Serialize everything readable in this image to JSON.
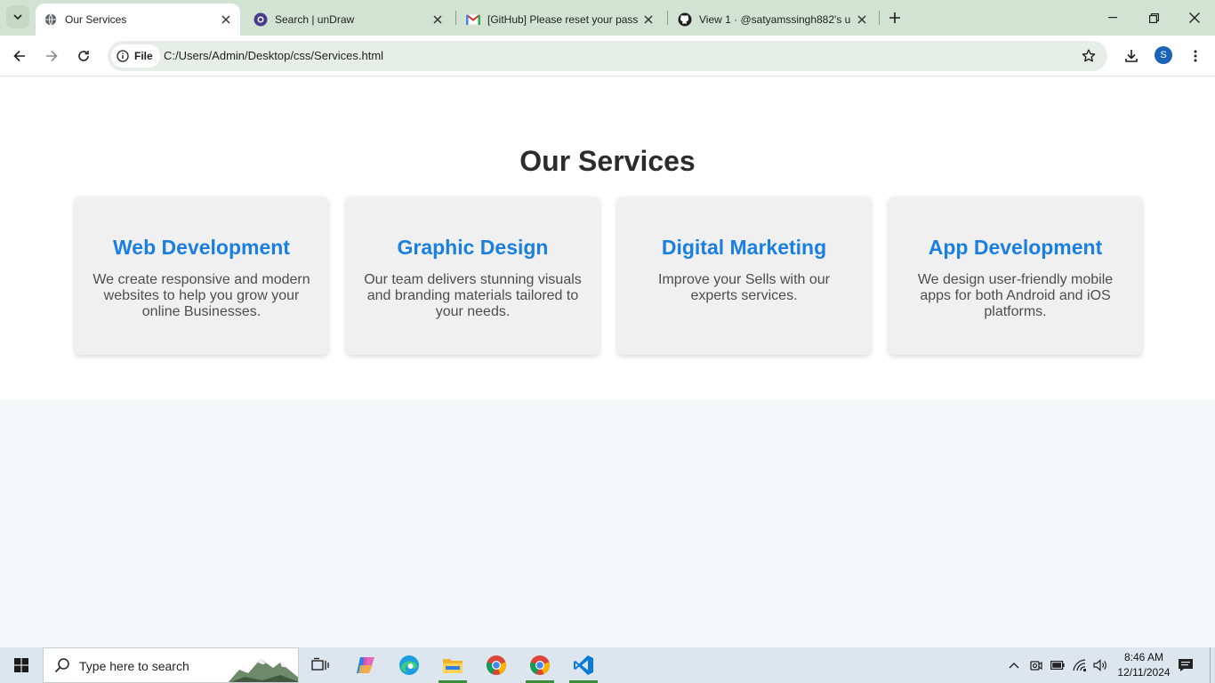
{
  "browser": {
    "tabs": [
      {
        "title": "Our Services",
        "active": true,
        "icon": "globe-icon"
      },
      {
        "title": "Search | unDraw",
        "active": false,
        "icon": "undraw-icon"
      },
      {
        "title": "[GitHub] Please reset your pass",
        "active": false,
        "icon": "gmail-icon"
      },
      {
        "title": "View 1 · @satyamssingh882's u",
        "active": false,
        "icon": "github-icon"
      }
    ],
    "address": {
      "chip_label": "File",
      "url": "C:/Users/Admin/Desktop/css/Services.html"
    },
    "profile_initial": "S"
  },
  "page": {
    "heading": "Our Services",
    "cards": [
      {
        "title": "Web Development",
        "text": "We create responsive and modern websites to help you grow your online Businesses."
      },
      {
        "title": "Graphic Design",
        "text": "Our team delivers stunning visuals and branding materials tailored to your needs."
      },
      {
        "title": "Digital Marketing",
        "text": "Improve your Sells with our experts services."
      },
      {
        "title": "App Development",
        "text": "We design user-friendly mobile apps for both Android and iOS platforms."
      }
    ],
    "colors": {
      "card_title": "#1a7fe0",
      "heading": "#2c2c2c",
      "card_bg": "#f0f0f0"
    }
  },
  "taskbar": {
    "search_placeholder": "Type here to search",
    "time": "8:46 AM",
    "date": "12/11/2024",
    "apps": [
      "task-view-icon",
      "copilot-icon",
      "edge-icon",
      "file-explorer-icon",
      "chrome-icon",
      "chrome-icon",
      "vscode-icon"
    ]
  }
}
